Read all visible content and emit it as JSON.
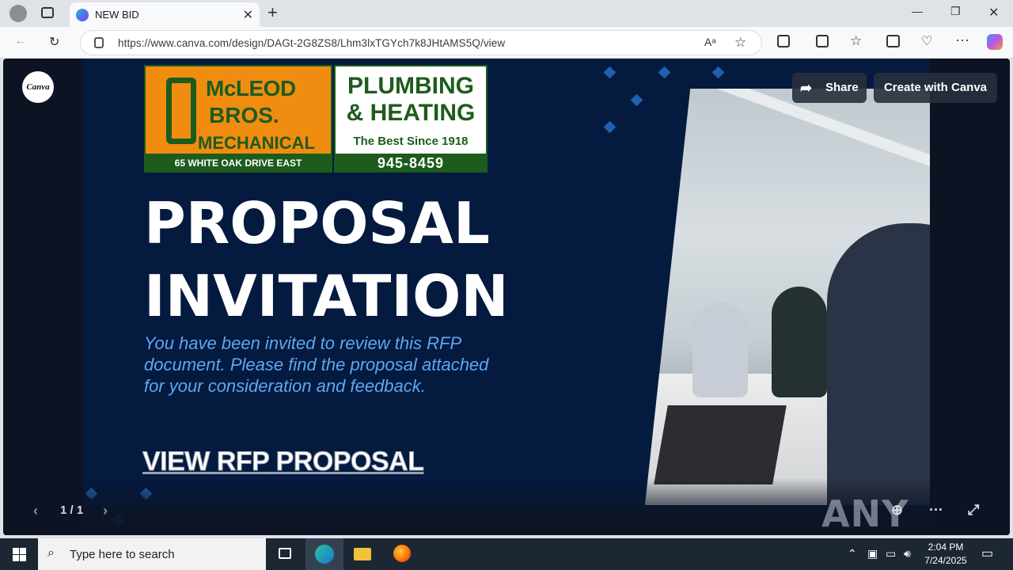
{
  "browser": {
    "tab_title": "NEW BID",
    "tab_close": "✕",
    "new_tab": "+",
    "url": "https://www.canva.com/design/DAGt-2G8ZS8/Lhm3lxTGYch7k8JHtAMS5Q/view",
    "window_controls": {
      "minimize": "—",
      "maximize": "❐",
      "close": "✕"
    },
    "icons": [
      "back-icon",
      "refresh-icon",
      "lock-icon",
      "read-aloud-icon",
      "favorite-icon",
      "extensions-icon",
      "split-screen-icon",
      "favorites-icon",
      "collections-icon",
      "browser-essentials-icon",
      "more-icon",
      "copilot-icon"
    ]
  },
  "canva": {
    "logo_text": "Canva",
    "share_label": "Share",
    "create_label": "Create with Canva",
    "page_indicator": "1 / 1"
  },
  "slide": {
    "logo": {
      "company_line1": "McLEOD",
      "company_line2": "BROS.",
      "company_line3": "MECHANICAL",
      "address": "65 WHITE OAK DRIVE EAST",
      "service_line1": "PLUMBING",
      "service_line2": "& HEATING",
      "tagline": "The Best Since 1918",
      "phone": "945-8459"
    },
    "heading_line1": "PROPOSAL",
    "heading_line2": "INVITATION",
    "body": "You have been invited to review this RFP document. Please find the proposal attached for your consideration and feedback.",
    "cta": "VIEW RFP PROPOSAL"
  },
  "watermark": "ANY RUN",
  "taskbar": {
    "search_placeholder": "Type here to search",
    "time": "2:04 PM",
    "date": "7/24/2025"
  },
  "colors": {
    "slide_bg": "#041a3f",
    "accent_blue": "#1f61b0",
    "body_text": "#5da8f0",
    "logo_green": "#1d5c1d",
    "logo_orange": "#f08c10"
  }
}
